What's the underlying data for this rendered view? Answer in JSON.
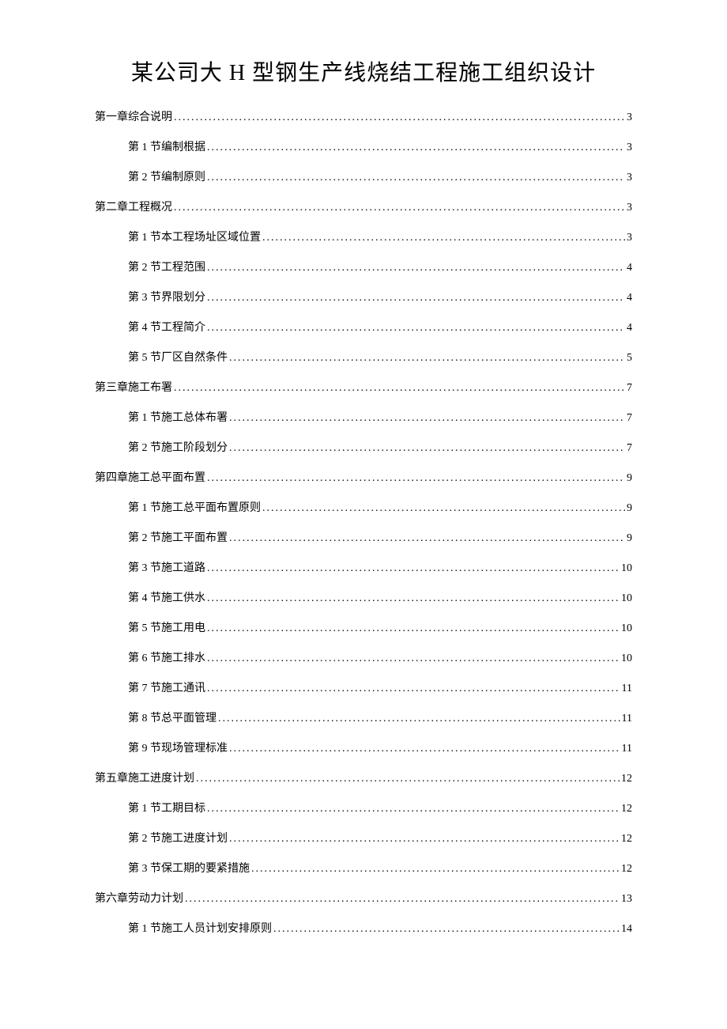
{
  "title": "某公司大 H 型钢生产线烧结工程施工组织设计",
  "toc": [
    {
      "level": 1,
      "label": "第一章综合说明",
      "page": "3"
    },
    {
      "level": 2,
      "label": "第 1 节编制根据",
      "page": "3"
    },
    {
      "level": 2,
      "label": "第 2 节编制原则",
      "page": "3"
    },
    {
      "level": 1,
      "label": "第二章工程概况",
      "page": "3"
    },
    {
      "level": 2,
      "label": "第 1 节本工程场址区域位置",
      "page": "3"
    },
    {
      "level": 2,
      "label": "第 2 节工程范围",
      "page": "4"
    },
    {
      "level": 2,
      "label": "第 3 节界限划分",
      "page": "4"
    },
    {
      "level": 2,
      "label": "第 4 节工程简介",
      "page": "4"
    },
    {
      "level": 2,
      "label": "第 5 节厂区自然条件",
      "page": "5"
    },
    {
      "level": 1,
      "label": "第三章施工布署",
      "page": "7"
    },
    {
      "level": 2,
      "label": "第 1 节施工总体布署",
      "page": "7"
    },
    {
      "level": 2,
      "label": "第 2 节施工阶段划分",
      "page": "7"
    },
    {
      "level": 1,
      "label": "第四章施工总平面布置",
      "page": "9"
    },
    {
      "level": 2,
      "label": "第 1 节施工总平面布置原则",
      "page": "9"
    },
    {
      "level": 2,
      "label": "第 2 节施工平面布置",
      "page": "9"
    },
    {
      "level": 2,
      "label": "第 3 节施工道路",
      "page": "10"
    },
    {
      "level": 2,
      "label": "第 4 节施工供水",
      "page": "10"
    },
    {
      "level": 2,
      "label": "第 5 节施工用电",
      "page": "10"
    },
    {
      "level": 2,
      "label": "第 6 节施工排水",
      "page": "10"
    },
    {
      "level": 2,
      "label": "第 7 节施工通讯",
      "page": "11"
    },
    {
      "level": 2,
      "label": "第 8 节总平面管理",
      "page": "11"
    },
    {
      "level": 2,
      "label": "第 9 节现场管理标准",
      "page": "11"
    },
    {
      "level": 1,
      "label": "第五章施工进度计划",
      "page": "12"
    },
    {
      "level": 2,
      "label": "第 1 节工期目标",
      "page": "12"
    },
    {
      "level": 2,
      "label": "第 2 节施工进度计划",
      "page": "12"
    },
    {
      "level": 2,
      "label": "第 3 节保工期的要紧措施",
      "page": "12"
    },
    {
      "level": 1,
      "label": "第六章劳动力计划",
      "page": "13"
    },
    {
      "level": 2,
      "label": "第 1 节施工人员计划安排原则",
      "page": "14"
    }
  ]
}
